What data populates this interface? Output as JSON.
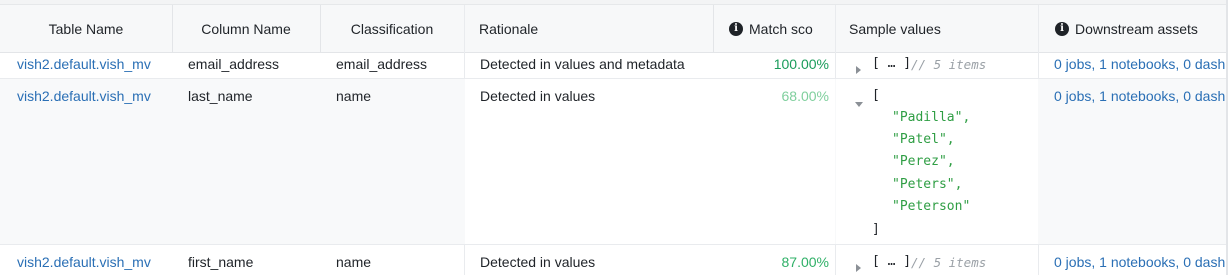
{
  "columns": {
    "table_name": "Table Name",
    "column_name": "Column Name",
    "classification": "Classification",
    "rationale": "Rationale",
    "match_score": "Match sco",
    "sample_values": "Sample values",
    "downstream_assets": "Downstream assets"
  },
  "rows": [
    {
      "table_name": "vish2.default.vish_mv",
      "column_name": "email_address",
      "classification": "email_address",
      "rationale": "Detected in values and metadata",
      "match_score": "100.00%",
      "score_color": "#1a9c5b",
      "sample_collapsed": "[ … ]",
      "sample_count": "// 5 items",
      "downstream": "0 jobs, 1 notebooks, 0 dashb"
    },
    {
      "table_name": "vish2.default.vish_mv",
      "column_name": "last_name",
      "classification": "name",
      "rationale": "Detected in values",
      "match_score": "68.00%",
      "score_color": "#7fcf9d",
      "sample_open": "[",
      "sample_close": "]",
      "sample_items": [
        "\"Padilla\",",
        "\"Patel\",",
        "\"Perez\",",
        "\"Peters\",",
        "\"Peterson\""
      ],
      "downstream": "0 jobs, 1 notebooks, 0 dashb"
    },
    {
      "table_name": "vish2.default.vish_mv",
      "column_name": "first_name",
      "classification": "name",
      "rationale": "Detected in values",
      "match_score": "87.00%",
      "score_color": "#2fb067",
      "sample_collapsed": "[ … ]",
      "sample_count": "// 5 items",
      "downstream": "0 jobs, 1 notebooks, 0 dashb"
    }
  ],
  "icons": {
    "match_score_info": "info-icon",
    "downstream_info": "info-icon",
    "expand": "triangle-right-icon",
    "collapse": "triangle-down-icon"
  }
}
